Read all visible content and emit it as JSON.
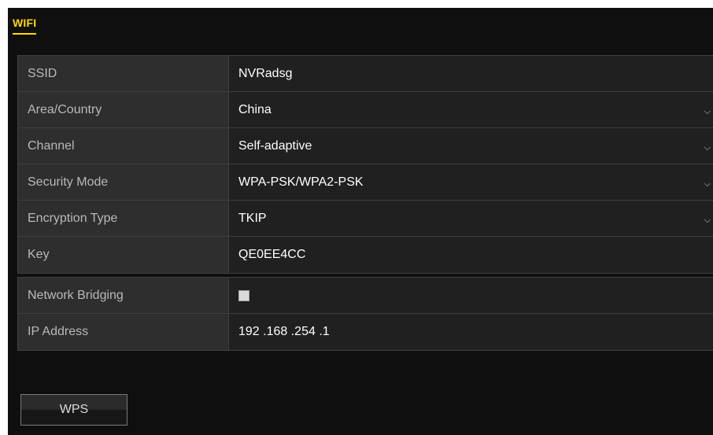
{
  "tab": {
    "label": "WIFI"
  },
  "fields": [
    {
      "label": "SSID",
      "value": "NVRadsg"
    },
    {
      "label": "Area/Country",
      "value": "China"
    },
    {
      "label": "Channel",
      "value": "Self-adaptive"
    },
    {
      "label": "Security Mode",
      "value": "WPA-PSK/WPA2-PSK"
    },
    {
      "label": "Encryption Type",
      "value": "TKIP"
    },
    {
      "label": "Key",
      "value": "QE0EE4CC"
    }
  ],
  "bridging": {
    "label": "Network Bridging",
    "checked": false
  },
  "ip": {
    "label": "IP Address",
    "value": "192 .168 .254 .1"
  },
  "buttons": {
    "wps": "WPS"
  },
  "colors": {
    "accent": "#ffd800",
    "panel_bg": "#0f0f0f",
    "label_bg": "#2e2e2e",
    "value_bg": "#202020"
  },
  "icons": {
    "dropdown": "chevron-down-icon",
    "checkbox": "checkbox-icon"
  }
}
